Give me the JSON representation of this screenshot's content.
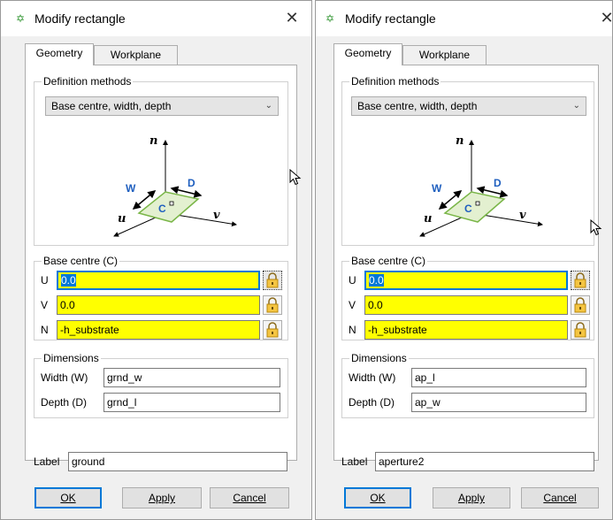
{
  "dialogs": [
    {
      "title": "Modify rectangle",
      "close_glyph": "✕",
      "tabs": [
        "Geometry",
        "Workplane"
      ],
      "definition_methods": {
        "title": "Definition methods",
        "selected": "Base centre, width, depth"
      },
      "diagram": {
        "n": "n",
        "u": "u",
        "v": "v",
        "w": "W",
        "d": "D",
        "c": "C"
      },
      "base_centre": {
        "title": "Base centre (C)",
        "u_label": "U",
        "u_value": "0.0",
        "v_label": "V",
        "v_value": "0.0",
        "n_label": "N",
        "n_value": "-h_substrate"
      },
      "dimensions": {
        "title": "Dimensions",
        "width_label": "Width (W)",
        "width_value": "grnd_w",
        "depth_label": "Depth (D)",
        "depth_value": "grnd_l"
      },
      "label": {
        "label": "Label",
        "value": "ground"
      },
      "buttons": {
        "ok": "OK",
        "apply": "Apply",
        "cancel": "Cancel"
      }
    },
    {
      "title": "Modify rectangle",
      "close_glyph": "✕",
      "tabs": [
        "Geometry",
        "Workplane"
      ],
      "definition_methods": {
        "title": "Definition methods",
        "selected": "Base centre, width, depth"
      },
      "diagram": {
        "n": "n",
        "u": "u",
        "v": "v",
        "w": "W",
        "d": "D",
        "c": "C"
      },
      "base_centre": {
        "title": "Base centre (C)",
        "u_label": "U",
        "u_value": "0.0",
        "v_label": "V",
        "v_value": "0.0",
        "n_label": "N",
        "n_value": "-h_substrate"
      },
      "dimensions": {
        "title": "Dimensions",
        "width_label": "Width (W)",
        "width_value": "ap_l",
        "depth_label": "Depth (D)",
        "depth_value": "ap_w"
      },
      "label": {
        "label": "Label",
        "value": "aperture2"
      },
      "buttons": {
        "ok": "OK",
        "apply": "Apply",
        "cancel": "Cancel"
      }
    }
  ],
  "colors": {
    "field_highlight": "#ffff00",
    "focus_border": "#0078d7",
    "rect_fill": "#e3f0d0",
    "rect_stroke": "#7ab648",
    "arrow_color": "#000000",
    "app_icon": "#3a9a3a"
  },
  "icons": {
    "app": "app-logo-icon",
    "close": "close-icon",
    "dropdown": "chevron-down-icon",
    "lock": "lock-icon",
    "cursor": "mouse-pointer-icon"
  }
}
